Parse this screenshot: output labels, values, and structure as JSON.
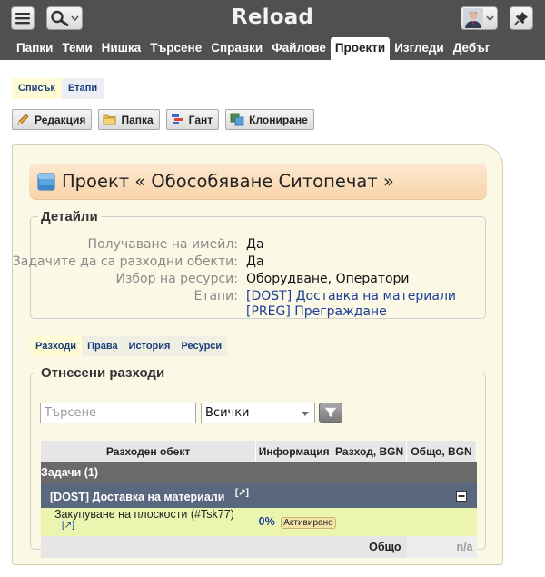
{
  "app": {
    "title": "Reload"
  },
  "nav": {
    "tabs": [
      "Папки",
      "Теми",
      "Нишка",
      "Търсене",
      "Справки",
      "Файлове",
      "Проекти",
      "Изгледи",
      "Дебъг"
    ],
    "active": "Проекти"
  },
  "subtabs": [
    "Списък",
    "Етапи"
  ],
  "toolbar": {
    "edit": "Редакция",
    "folder": "Папка",
    "gantt": "Гант",
    "clone": "Клониране"
  },
  "project": {
    "title": "Проект « Обособяване Ситопечат »"
  },
  "details": {
    "legend": "Детайли",
    "rows": [
      {
        "label": "Получаване на имейл:",
        "value": "Да"
      },
      {
        "label": "Задачите да са разходни обекти:",
        "value": "Да"
      },
      {
        "label": "Избор на ресурси:",
        "value": "Оборудване, Оператори"
      },
      {
        "label": "Етапи:",
        "value": "[DOST] Доставка на материали"
      }
    ],
    "stage2": "[PREG] Преграждане"
  },
  "tabs2": [
    "Разходи",
    "Права",
    "История",
    "Ресурси"
  ],
  "expenses": {
    "legend": "Отнесени разходи",
    "search_placeholder": "Търсене",
    "select_value": "Всички",
    "headers": [
      "Разходен обект",
      "Информация",
      "Разход, BGN",
      "Общо, BGN"
    ],
    "group": "Задачи (1)",
    "subgroup": "[DOST] Доставка на материали",
    "task": {
      "name": "Закупуване на плоскости (#Tsk77)",
      "percent": "0%",
      "status": "Активирано"
    },
    "total_label": "Общо",
    "total_value": "n/a"
  },
  "colors": {
    "topbar": "#505050",
    "panel": "#fcf8e6",
    "task_row": "#ebf5b0",
    "subgroup_row": "#59687f",
    "link": "#1b3e96"
  }
}
